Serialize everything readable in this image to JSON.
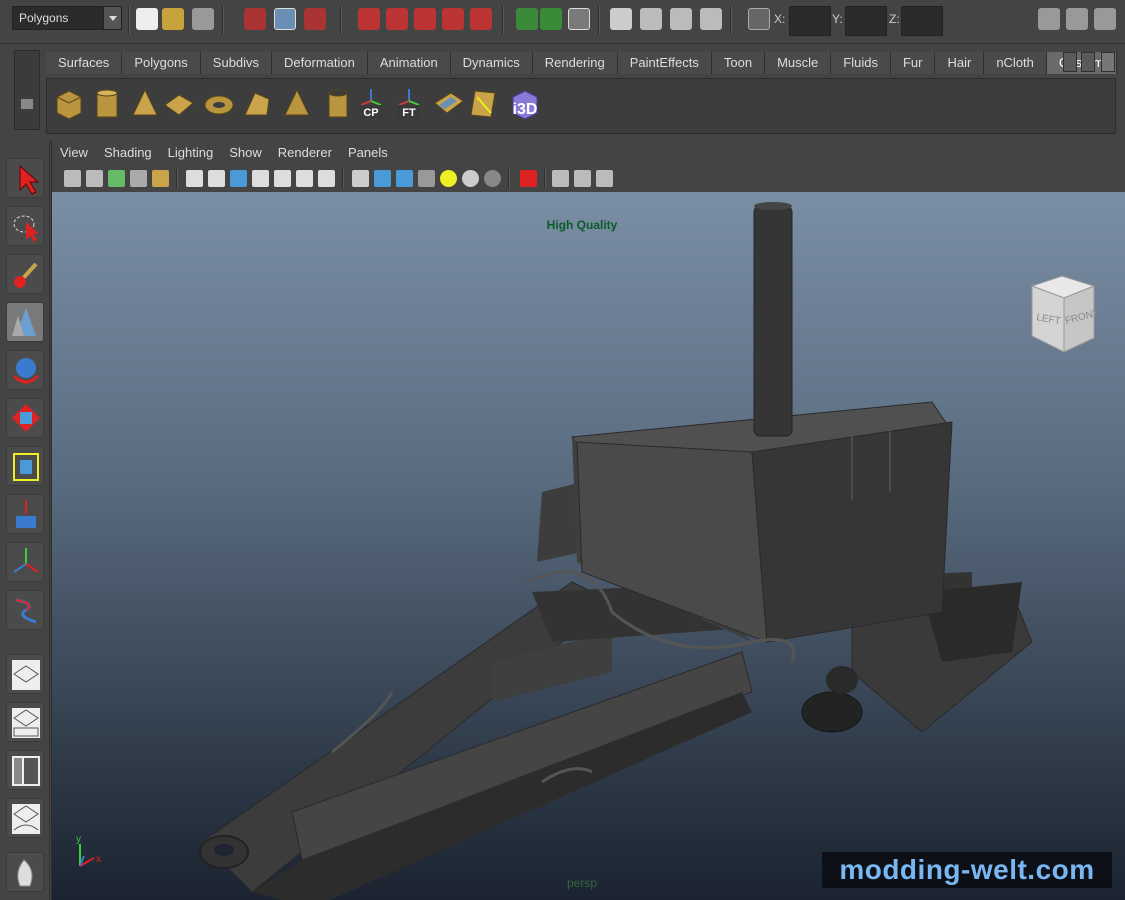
{
  "status_line": {
    "mode": "Polygons",
    "coords": {
      "x_label": "X:",
      "y_label": "Y:",
      "z_label": "Z:",
      "x_value": "",
      "y_value": "",
      "z_value": ""
    }
  },
  "shelf": {
    "tabs": [
      "Surfaces",
      "Polygons",
      "Subdivs",
      "Deformation",
      "Animation",
      "Dynamics",
      "Rendering",
      "PaintEffects",
      "Toon",
      "Muscle",
      "Fluids",
      "Fur",
      "Hair",
      "nCloth",
      "Custom"
    ],
    "active_tab": "Custom",
    "icon_labels": {
      "cp": "CP",
      "ft": "FT",
      "i3d": "i3D"
    }
  },
  "panel": {
    "menus": [
      "View",
      "Shading",
      "Lighting",
      "Show",
      "Renderer",
      "Panels"
    ]
  },
  "viewport": {
    "quality_label": "High Quality",
    "camera": "persp",
    "viewcube_faces": {
      "left": "LEFT",
      "front": "FRONT"
    },
    "axis": {
      "x": "x",
      "y": "y"
    }
  },
  "watermark": "modding-welt.com"
}
